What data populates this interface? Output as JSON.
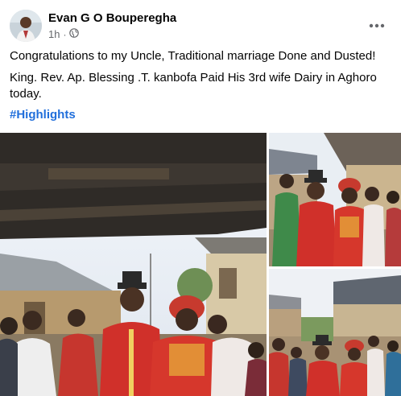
{
  "post": {
    "author": "Evan G O Bouperegha",
    "time": "1h",
    "audience_icon": "globe-icon",
    "more_icon": "more-horizontal-icon",
    "paragraphs": [
      "Congratulations to my Uncle, Traditional marriage Done and Dusted!",
      "King. Rev. Ap. Blessing .T. kanbofa Paid His 3rd wife  Dairy in Aghoro today."
    ],
    "hashtag": "#Highlights"
  },
  "media": {
    "photo_count_visible": 3,
    "photos": [
      {
        "name": "photo-main",
        "description_icon": "photo-icon"
      },
      {
        "name": "photo-top-right",
        "description_icon": "photo-icon"
      },
      {
        "name": "photo-bottom-right",
        "description_icon": "photo-icon"
      }
    ]
  },
  "colors": {
    "text_primary": "#050505",
    "text_secondary": "#65676b",
    "link": "#216fdb",
    "background": "#ffffff"
  }
}
